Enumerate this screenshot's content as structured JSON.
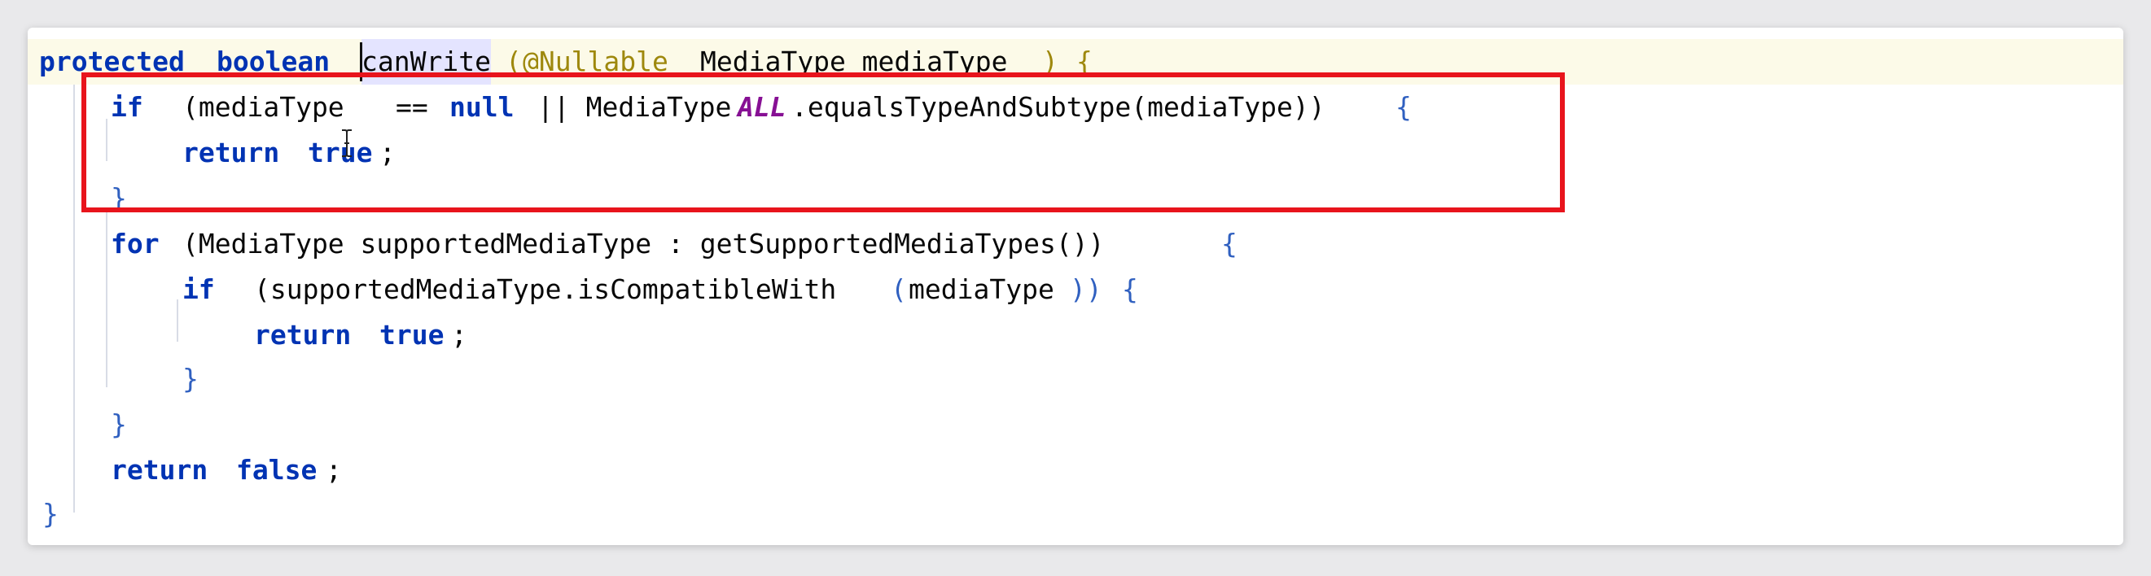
{
  "editor": {
    "lines": [
      {
        "t1": "protected",
        "t2": "boolean",
        "t3": "canWrite",
        "t4": "(",
        "t5": "@Nullable",
        "t6": "MediaType mediaType",
        "t7": ")",
        "t8": "{"
      },
      {
        "t1": "if",
        "t2": "(mediaType",
        "t3": "==",
        "t4": "null",
        "t5": "|| MediaType.",
        "t6": "ALL",
        "t7": ".equalsTypeAndSubtype(mediaType))",
        "t8": "{"
      },
      {
        "t1": "return",
        "t2": "true",
        "t3": ";"
      },
      {
        "t1": "}"
      },
      {
        "t1": "for",
        "t2": "(MediaType supportedMediaType : getSupportedMediaTypes())",
        "t3": "{"
      },
      {
        "t1": "if",
        "t2": "(supportedMediaType.isCompatibleWith",
        "t3": "(",
        "t4": "mediaType",
        "t5": "))",
        "t6": "{"
      },
      {
        "t1": "return",
        "t2": "true",
        "t3": ";"
      },
      {
        "t1": "}"
      },
      {
        "t1": "}"
      },
      {
        "t1": "return",
        "t2": "false",
        "t3": ";"
      },
      {
        "t1": "}"
      }
    ]
  },
  "colors": {
    "keyword": "#0033b3",
    "annotation": "#9e880d",
    "static_field": "#871094",
    "brace": "#3060c0",
    "current_line": "#fcfae8",
    "method_highlight": "#e4e4ff",
    "highlight_box": "#e8141c"
  },
  "icons": {
    "cursor": "text-cursor-icon"
  }
}
